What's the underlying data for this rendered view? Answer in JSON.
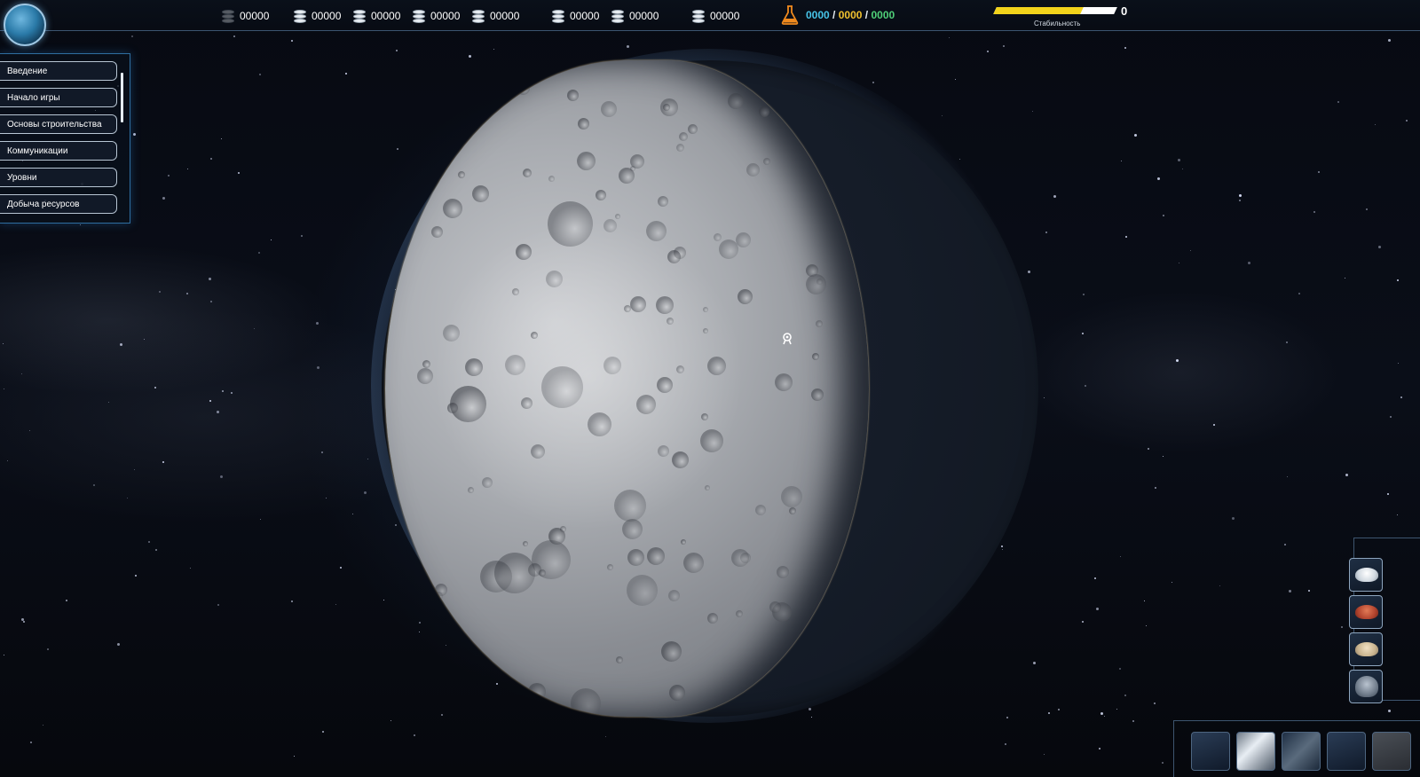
{
  "top_bar": {
    "resources": [
      {
        "icon": "stack-icon",
        "value": "00000"
      },
      {
        "icon": "stack-icon",
        "value": "00000"
      },
      {
        "icon": "stack-icon",
        "value": "00000"
      },
      {
        "icon": "stack-icon",
        "value": "00000"
      },
      {
        "icon": "stack-icon",
        "value": "00000"
      },
      {
        "icon": "stack-icon",
        "value": "00000"
      },
      {
        "icon": "stack-icon",
        "value": "00000"
      },
      {
        "icon": "stack-icon",
        "value": "00000"
      }
    ],
    "science": {
      "icon": "flask-icon",
      "a": "0000",
      "b": "0000",
      "c": "0000",
      "sep": "/"
    },
    "stability": {
      "label": "Стабильность",
      "value": "0",
      "fill_fraction": 0.72
    }
  },
  "tutorial_menu": {
    "items": [
      {
        "label": "Введение"
      },
      {
        "label": "Начало игры"
      },
      {
        "label": "Основы строительства"
      },
      {
        "label": "Коммуникации"
      },
      {
        "label": "Уровни"
      },
      {
        "label": "Добыча ресурсов"
      }
    ]
  },
  "planet": {
    "name": "moon",
    "marker_icon": "location-marker-icon"
  },
  "side_slots": [
    {
      "icon": "snow-resource-icon"
    },
    {
      "icon": "red-ore-icon"
    },
    {
      "icon": "sand-resource-icon"
    },
    {
      "icon": "rock-ore-icon"
    }
  ],
  "bottom_buttons": [
    {
      "icon": "build-icon"
    },
    {
      "icon": "scan-icon"
    },
    {
      "icon": "terrain-icon"
    },
    {
      "icon": "map-icon"
    },
    {
      "icon": "settings-icon"
    }
  ],
  "colors": {
    "science_a": "#47c4e8",
    "science_b": "#f1c12f",
    "science_c": "#4fcf78",
    "stability_fill": "#f2d31b",
    "frame": "#3c5470"
  }
}
